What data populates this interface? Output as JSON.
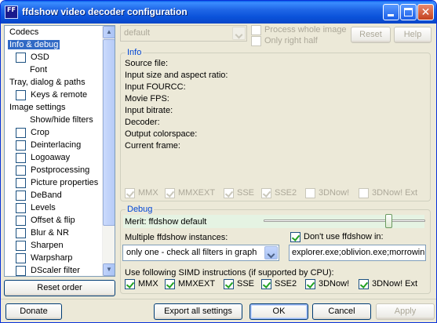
{
  "window": {
    "title": "ffdshow video decoder configuration",
    "icon": "FF"
  },
  "tree": {
    "items": [
      {
        "label": "Codecs",
        "indent": false,
        "checkbox": false
      },
      {
        "label": "Info & debug",
        "indent": false,
        "checkbox": false,
        "selected": true
      },
      {
        "label": "OSD",
        "indent": true,
        "checkbox": true,
        "checked": false
      },
      {
        "label": "Font",
        "indent": true,
        "checkbox": false
      },
      {
        "label": "Tray, dialog & paths",
        "indent": false,
        "checkbox": false
      },
      {
        "label": "Keys & remote",
        "indent": true,
        "checkbox": true,
        "checked": false
      },
      {
        "label": "Image settings",
        "indent": false,
        "checkbox": false
      },
      {
        "label": "Show/hide filters",
        "indent": true,
        "checkbox": false
      },
      {
        "label": "Crop",
        "indent": true,
        "checkbox": true,
        "checked": false
      },
      {
        "label": "Deinterlacing",
        "indent": true,
        "checkbox": true,
        "checked": false
      },
      {
        "label": "Logoaway",
        "indent": true,
        "checkbox": true,
        "checked": false
      },
      {
        "label": "Postprocessing",
        "indent": true,
        "checkbox": true,
        "checked": false
      },
      {
        "label": "Picture properties",
        "indent": true,
        "checkbox": true,
        "checked": false
      },
      {
        "label": "DeBand",
        "indent": true,
        "checkbox": true,
        "checked": false
      },
      {
        "label": "Levels",
        "indent": true,
        "checkbox": true,
        "checked": false
      },
      {
        "label": "Offset & flip",
        "indent": true,
        "checkbox": true,
        "checked": false
      },
      {
        "label": "Blur & NR",
        "indent": true,
        "checkbox": true,
        "checked": false
      },
      {
        "label": "Sharpen",
        "indent": true,
        "checkbox": true,
        "checked": false
      },
      {
        "label": "Warpsharp",
        "indent": true,
        "checkbox": true,
        "checked": false
      },
      {
        "label": "DScaler filter",
        "indent": true,
        "checkbox": true,
        "checked": false
      }
    ]
  },
  "reset_order_label": "Reset order",
  "top": {
    "preset_value": "default",
    "process_whole_image": "Process whole image",
    "only_right_half": "Only right half",
    "reset_label": "Reset",
    "help_label": "Help"
  },
  "info": {
    "title": "Info",
    "lines": [
      "Source file:",
      "Input size and aspect ratio:",
      "Input FOURCC:",
      "Movie FPS:",
      "Input bitrate:",
      "Decoder:",
      "Output colorspace:",
      "Current frame:"
    ],
    "simd": [
      "MMX",
      "MMXEXT",
      "SSE",
      "SSE2",
      "3DNow!",
      "3DNow! Ext"
    ],
    "simd_checked": [
      true,
      true,
      true,
      true,
      false,
      false
    ]
  },
  "debug": {
    "title": "Debug",
    "merit_label": "Merit: ffdshow default",
    "merit_level": 0.77,
    "multiple_instances_label": "Multiple ffdshow instances:",
    "instances_value": "only one - check all filters in graph",
    "dont_use_label": "Don't use ffdshow in:",
    "dont_use_value": "explorer.exe;oblivion.exe;morrowin",
    "simd_label": "Use following SIMD instructions (if supported by CPU):",
    "simd": [
      "MMX",
      "MMXEXT",
      "SSE",
      "SSE2",
      "3DNow!",
      "3DNow! Ext"
    ],
    "simd_checked": [
      true,
      true,
      true,
      true,
      true,
      true
    ]
  },
  "bottom": {
    "donate": "Donate",
    "export": "Export all settings",
    "ok": "OK",
    "cancel": "Cancel",
    "apply": "Apply"
  },
  "colors": {
    "titlebar": "#0b53db",
    "selection": "#316ac5",
    "group_title": "#0046d5",
    "window_bg": "#ece9d8"
  }
}
